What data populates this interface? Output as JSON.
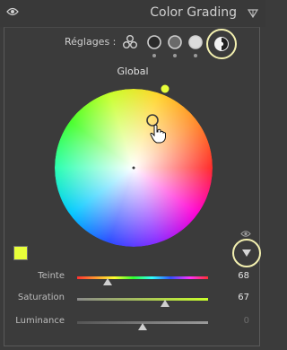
{
  "header": {
    "title": "Color Grading"
  },
  "settings": {
    "label": "Réglages :",
    "modes": [
      "three-way",
      "shadows",
      "midtones",
      "highlights",
      "global"
    ],
    "selected": "global"
  },
  "scope_label": "Global",
  "color": {
    "swatch": "#e8ff3a",
    "accent": "#f3f0b0"
  },
  "sliders": [
    {
      "label": "Teinte",
      "value": "68"
    },
    {
      "label": "Saturation",
      "value": "67"
    },
    {
      "label": "Luminance",
      "value": "0"
    }
  ],
  "slider_positions": {
    "hue": 0.23,
    "saturation": 0.67,
    "luminance": 0.5
  }
}
